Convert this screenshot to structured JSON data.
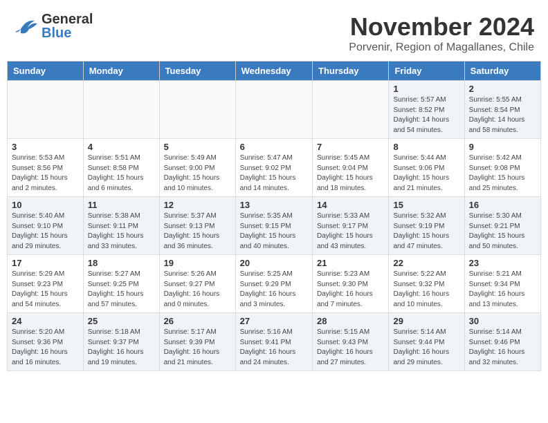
{
  "header": {
    "logo_general": "General",
    "logo_blue": "Blue",
    "month_title": "November 2024",
    "subtitle": "Porvenir, Region of Magallanes, Chile"
  },
  "weekdays": [
    "Sunday",
    "Monday",
    "Tuesday",
    "Wednesday",
    "Thursday",
    "Friday",
    "Saturday"
  ],
  "weeks": [
    [
      {
        "day": "",
        "info": ""
      },
      {
        "day": "",
        "info": ""
      },
      {
        "day": "",
        "info": ""
      },
      {
        "day": "",
        "info": ""
      },
      {
        "day": "",
        "info": ""
      },
      {
        "day": "1",
        "info": "Sunrise: 5:57 AM\nSunset: 8:52 PM\nDaylight: 14 hours\nand 54 minutes."
      },
      {
        "day": "2",
        "info": "Sunrise: 5:55 AM\nSunset: 8:54 PM\nDaylight: 14 hours\nand 58 minutes."
      }
    ],
    [
      {
        "day": "3",
        "info": "Sunrise: 5:53 AM\nSunset: 8:56 PM\nDaylight: 15 hours\nand 2 minutes."
      },
      {
        "day": "4",
        "info": "Sunrise: 5:51 AM\nSunset: 8:58 PM\nDaylight: 15 hours\nand 6 minutes."
      },
      {
        "day": "5",
        "info": "Sunrise: 5:49 AM\nSunset: 9:00 PM\nDaylight: 15 hours\nand 10 minutes."
      },
      {
        "day": "6",
        "info": "Sunrise: 5:47 AM\nSunset: 9:02 PM\nDaylight: 15 hours\nand 14 minutes."
      },
      {
        "day": "7",
        "info": "Sunrise: 5:45 AM\nSunset: 9:04 PM\nDaylight: 15 hours\nand 18 minutes."
      },
      {
        "day": "8",
        "info": "Sunrise: 5:44 AM\nSunset: 9:06 PM\nDaylight: 15 hours\nand 21 minutes."
      },
      {
        "day": "9",
        "info": "Sunrise: 5:42 AM\nSunset: 9:08 PM\nDaylight: 15 hours\nand 25 minutes."
      }
    ],
    [
      {
        "day": "10",
        "info": "Sunrise: 5:40 AM\nSunset: 9:10 PM\nDaylight: 15 hours\nand 29 minutes."
      },
      {
        "day": "11",
        "info": "Sunrise: 5:38 AM\nSunset: 9:11 PM\nDaylight: 15 hours\nand 33 minutes."
      },
      {
        "day": "12",
        "info": "Sunrise: 5:37 AM\nSunset: 9:13 PM\nDaylight: 15 hours\nand 36 minutes."
      },
      {
        "day": "13",
        "info": "Sunrise: 5:35 AM\nSunset: 9:15 PM\nDaylight: 15 hours\nand 40 minutes."
      },
      {
        "day": "14",
        "info": "Sunrise: 5:33 AM\nSunset: 9:17 PM\nDaylight: 15 hours\nand 43 minutes."
      },
      {
        "day": "15",
        "info": "Sunrise: 5:32 AM\nSunset: 9:19 PM\nDaylight: 15 hours\nand 47 minutes."
      },
      {
        "day": "16",
        "info": "Sunrise: 5:30 AM\nSunset: 9:21 PM\nDaylight: 15 hours\nand 50 minutes."
      }
    ],
    [
      {
        "day": "17",
        "info": "Sunrise: 5:29 AM\nSunset: 9:23 PM\nDaylight: 15 hours\nand 54 minutes."
      },
      {
        "day": "18",
        "info": "Sunrise: 5:27 AM\nSunset: 9:25 PM\nDaylight: 15 hours\nand 57 minutes."
      },
      {
        "day": "19",
        "info": "Sunrise: 5:26 AM\nSunset: 9:27 PM\nDaylight: 16 hours\nand 0 minutes."
      },
      {
        "day": "20",
        "info": "Sunrise: 5:25 AM\nSunset: 9:29 PM\nDaylight: 16 hours\nand 3 minutes."
      },
      {
        "day": "21",
        "info": "Sunrise: 5:23 AM\nSunset: 9:30 PM\nDaylight: 16 hours\nand 7 minutes."
      },
      {
        "day": "22",
        "info": "Sunrise: 5:22 AM\nSunset: 9:32 PM\nDaylight: 16 hours\nand 10 minutes."
      },
      {
        "day": "23",
        "info": "Sunrise: 5:21 AM\nSunset: 9:34 PM\nDaylight: 16 hours\nand 13 minutes."
      }
    ],
    [
      {
        "day": "24",
        "info": "Sunrise: 5:20 AM\nSunset: 9:36 PM\nDaylight: 16 hours\nand 16 minutes."
      },
      {
        "day": "25",
        "info": "Sunrise: 5:18 AM\nSunset: 9:37 PM\nDaylight: 16 hours\nand 19 minutes."
      },
      {
        "day": "26",
        "info": "Sunrise: 5:17 AM\nSunset: 9:39 PM\nDaylight: 16 hours\nand 21 minutes."
      },
      {
        "day": "27",
        "info": "Sunrise: 5:16 AM\nSunset: 9:41 PM\nDaylight: 16 hours\nand 24 minutes."
      },
      {
        "day": "28",
        "info": "Sunrise: 5:15 AM\nSunset: 9:43 PM\nDaylight: 16 hours\nand 27 minutes."
      },
      {
        "day": "29",
        "info": "Sunrise: 5:14 AM\nSunset: 9:44 PM\nDaylight: 16 hours\nand 29 minutes."
      },
      {
        "day": "30",
        "info": "Sunrise: 5:14 AM\nSunset: 9:46 PM\nDaylight: 16 hours\nand 32 minutes."
      }
    ]
  ]
}
